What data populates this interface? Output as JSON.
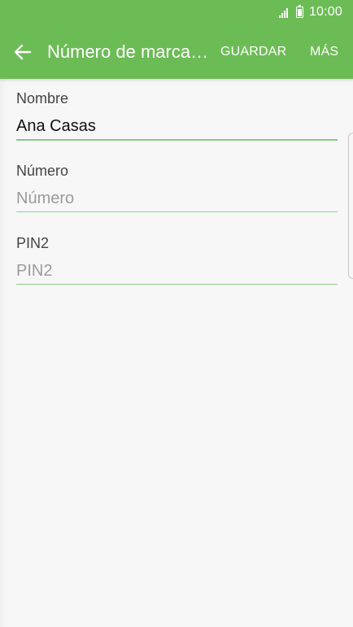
{
  "status_bar": {
    "time": "10:00",
    "icons": [
      "signal-icon",
      "battery-icon"
    ]
  },
  "app_bar": {
    "title": "Número de marcación fija",
    "back_icon": "arrow-left-icon",
    "actions": {
      "save_label": "GUARDAR",
      "more_label": "MÁS"
    },
    "background_color": "#6cbc55"
  },
  "form": {
    "fields": [
      {
        "label": "Nombre",
        "value": "Ana Casas",
        "placeholder": "Nombre"
      },
      {
        "label": "Número",
        "value": "",
        "placeholder": "Número"
      },
      {
        "label": "PIN2",
        "value": "",
        "placeholder": "PIN2"
      }
    ],
    "accent_color": "#8fd08a"
  }
}
